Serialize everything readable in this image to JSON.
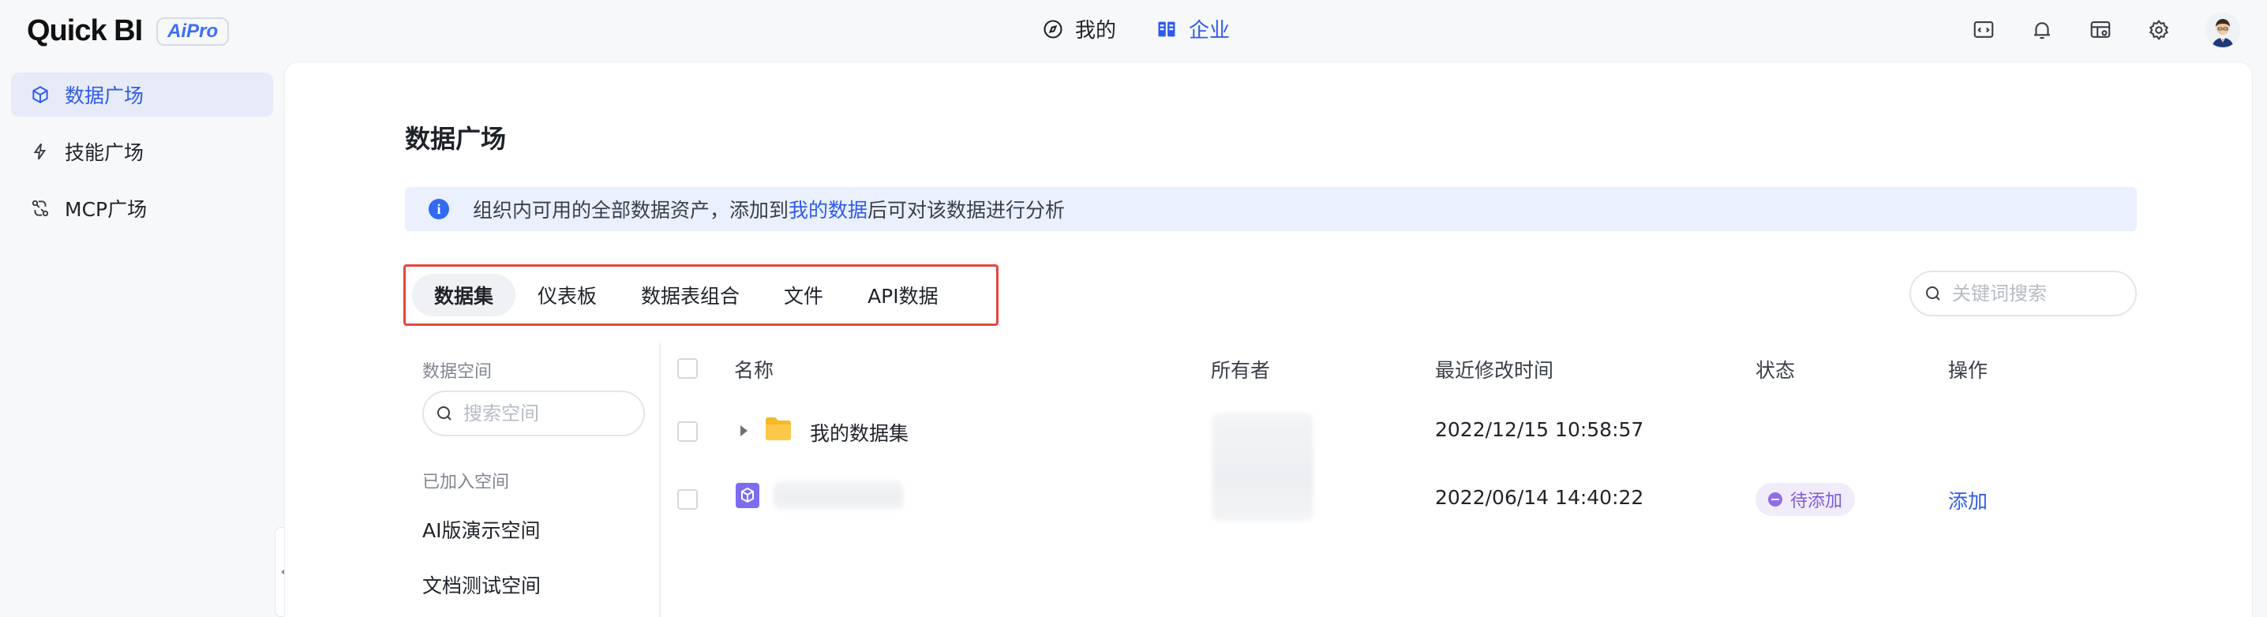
{
  "app": {
    "logo_text": "Quick BI",
    "logo_badge": "AiPro"
  },
  "topnav": {
    "items": [
      {
        "label": "我的",
        "icon": "compass-icon"
      },
      {
        "label": "企业",
        "icon": "building-icon",
        "active": true
      }
    ]
  },
  "sidebar": {
    "items": [
      {
        "label": "数据广场",
        "icon": "cube-icon",
        "active": true
      },
      {
        "label": "技能广场",
        "icon": "lightning-icon"
      },
      {
        "label": "MCP广场",
        "icon": "connector-icon"
      }
    ]
  },
  "main": {
    "title": "数据广场",
    "info": {
      "prefix": "组织内可用的全部数据资产，添加到",
      "link": "我的数据",
      "suffix": "后可对该数据进行分析"
    },
    "tabs": [
      {
        "label": "数据集",
        "active": true
      },
      {
        "label": "仪表板"
      },
      {
        "label": "数据表组合"
      },
      {
        "label": "文件"
      },
      {
        "label": "API数据"
      }
    ],
    "search_placeholder": "关键词搜索"
  },
  "space_panel": {
    "title": "数据空间",
    "search_placeholder": "搜索空间",
    "joined_label": "已加入空间",
    "spaces": [
      "AI版演示空间",
      "文档测试空间"
    ]
  },
  "table": {
    "columns": [
      "名称",
      "所有者",
      "最近修改时间",
      "状态",
      "操作"
    ],
    "rows": [
      {
        "name": "我的数据集",
        "type": "folder",
        "modified": "2022/12/15 10:58:57",
        "status": "",
        "action": ""
      },
      {
        "name": "",
        "type": "dataset",
        "modified": "2022/06/14 14:40:22",
        "status": "待添加",
        "action": "添加"
      }
    ]
  },
  "colors": {
    "accent": "#2f5bea",
    "highlight_border": "#e8453c",
    "status_purple": "#7c5bd9",
    "folder_yellow": "#f7b82a"
  }
}
